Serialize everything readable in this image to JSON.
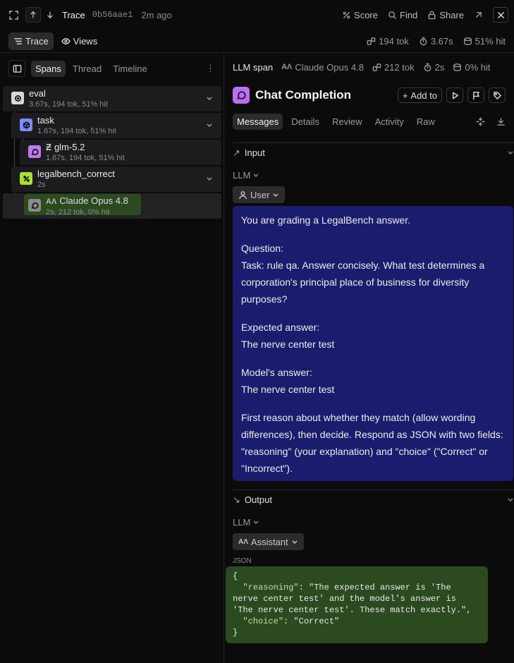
{
  "topbar": {
    "title": "Trace",
    "trace_id": "0b56aae1",
    "time_ago": "2m ago",
    "actions": {
      "score": "Score",
      "find": "Find",
      "share": "Share"
    }
  },
  "subbar": {
    "tabs": {
      "trace": "Trace",
      "views": "Views"
    },
    "metrics": {
      "tokens": "194 tok",
      "duration": "3.67s",
      "cache": "51% hit"
    }
  },
  "left": {
    "tabs": {
      "spans": "Spans",
      "thread": "Thread",
      "timeline": "Timeline"
    },
    "spans": [
      {
        "name": "eval",
        "meta": "3.67s, 194 tok, 51% hit",
        "color": "#d9d9d9"
      },
      {
        "name": "task",
        "meta": "1.67s, 194 tok, 51% hit",
        "color": "#7a8cff"
      },
      {
        "name": "glm-5.2",
        "meta": "1.67s, 194 tok, 51% hit",
        "color": "#c07af0"
      },
      {
        "name": "legalbench_correct",
        "meta": "2s",
        "color": "#a6e22e"
      },
      {
        "name": "Claude Opus 4.8",
        "meta": "2s, 212 tok, 0% hit",
        "color": "#8a8a8a"
      }
    ]
  },
  "right": {
    "header": {
      "kind": "LLM span",
      "model": "Claude Opus 4.8",
      "tokens": "212 tok",
      "duration": "2s",
      "cache": "0% hit"
    },
    "title": "Chat Completion",
    "add_to": "Add to",
    "tabs": {
      "messages": "Messages",
      "details": "Details",
      "review": "Review",
      "activity": "Activity",
      "raw": "Raw"
    },
    "input": {
      "label": "Input",
      "llm": "LLM",
      "role": "User",
      "paragraphs": [
        "You are grading a LegalBench answer.",
        "Question:\nTask: rule qa. Answer concisely. What test determines a corporation's principal place of business for diversity purposes?",
        "Expected answer:\nThe nerve center test",
        "Model's answer:\nThe nerve center test",
        "First reason about whether they match (allow wording differences), then decide. Respond as JSON with two fields: \"reasoning\" (your explanation) and \"choice\" (\"Correct\" or \"Incorrect\")."
      ]
    },
    "output": {
      "label": "Output",
      "llm": "LLM",
      "role": "Assistant",
      "json_label": "JSON",
      "reasoning_key": "\"reasoning\"",
      "reasoning_value": "\"The expected answer is 'The nerve center test' and the model's answer is 'The nerve center test'. These match exactly.\"",
      "choice_key": "\"choice\"",
      "choice_value": "\"Correct\""
    }
  }
}
